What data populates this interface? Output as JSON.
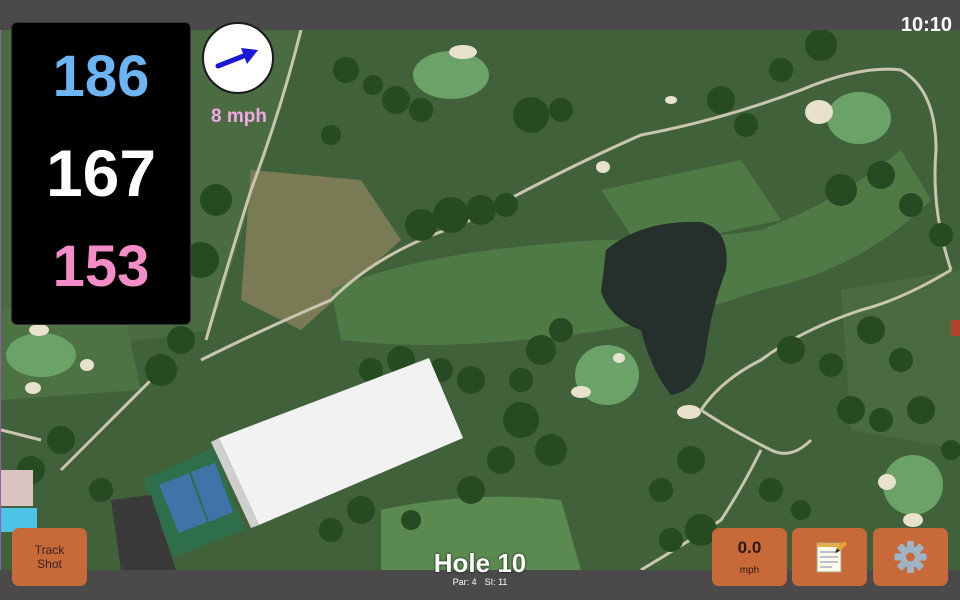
{
  "status_bar": {
    "time": "10:10"
  },
  "distances": {
    "back": "186",
    "middle": "167",
    "front": "153",
    "colors": {
      "back": "#6db4f2",
      "middle": "#ffffff",
      "front": "#f48cc8"
    }
  },
  "wind": {
    "speed_label": "8 mph",
    "arrow_icon": "wind-direction-arrow-icon",
    "label_color": "#f3a8e6"
  },
  "controls": {
    "track_shot_label": "Track Shot",
    "wind_readout": {
      "value": "0.0",
      "unit": "mph"
    },
    "notes_icon": "notepad-icon",
    "settings_icon": "gear-icon",
    "button_color": "#c8693a"
  },
  "hole": {
    "title": "Hole 10",
    "par": "Par: 4",
    "stroke_index": "SI: 11"
  }
}
